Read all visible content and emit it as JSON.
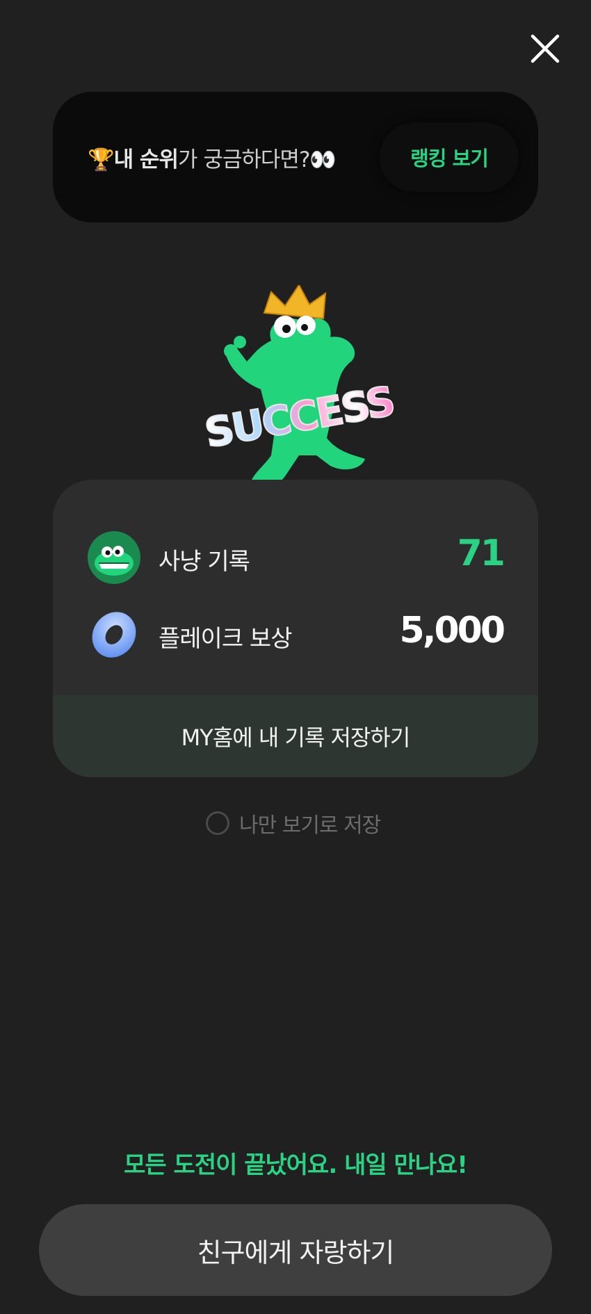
{
  "header": {
    "close_icon": "close-icon"
  },
  "rank_banner": {
    "trophy_emoji": "🏆",
    "highlight": "내 순위",
    "rest": "가 궁금하다면?",
    "eyes_emoji": "👀",
    "button_label": "랭킹 보기"
  },
  "mascot": {
    "icon": "success-dino-icon",
    "badge_text": "SUCCESS"
  },
  "result_card": {
    "hunt": {
      "icon": "dino-avatar-icon",
      "label": "사냥 기록",
      "value": "71"
    },
    "reward": {
      "icon": "flake-ring-icon",
      "label": "플레이크 보상",
      "value": "5,000"
    },
    "save_button": "MY홈에 내 기록 저장하기"
  },
  "private_option": {
    "label": "나만 보기로 저장",
    "checked": false
  },
  "footer": {
    "message": "모든 도전이 끝났어요. 내일 만나요!",
    "share_button": "친구에게 자랑하기"
  },
  "colors": {
    "background": "#202020",
    "accent": "#2ad383",
    "card": "#2d2d2d",
    "banner": "#0b0b0b"
  }
}
